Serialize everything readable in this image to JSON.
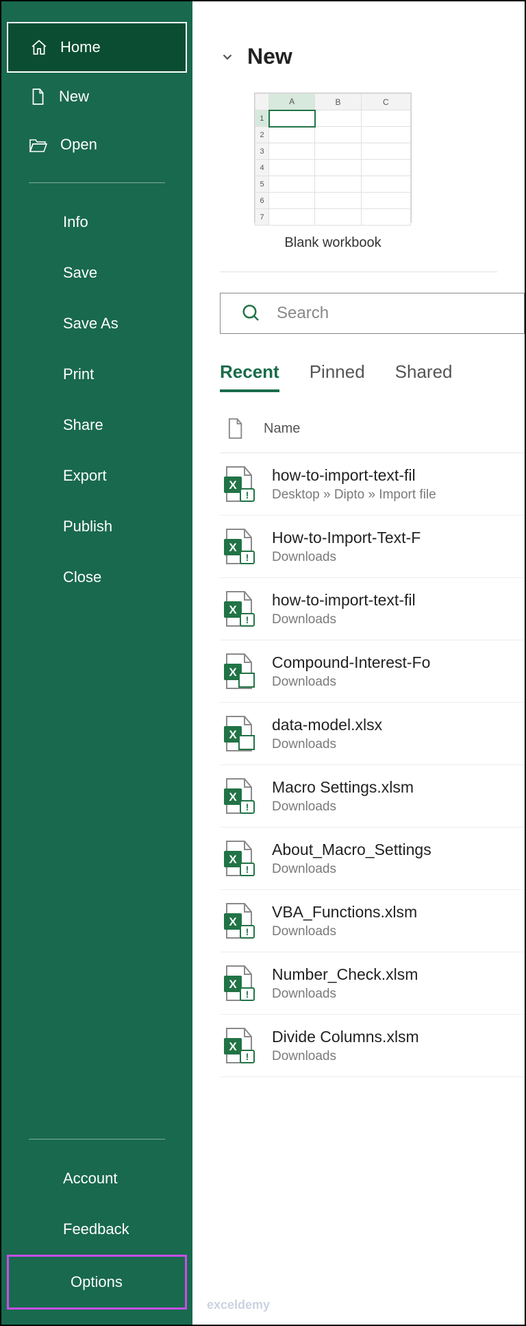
{
  "sidebar": {
    "primary": [
      {
        "label": "Home",
        "icon": "home-icon",
        "selected": true
      },
      {
        "label": "New",
        "icon": "file-icon"
      },
      {
        "label": "Open",
        "icon": "folder-open-icon"
      }
    ],
    "secondary": [
      "Info",
      "Save",
      "Save As",
      "Print",
      "Share",
      "Export",
      "Publish",
      "Close"
    ],
    "bottom": [
      "Account",
      "Feedback",
      "Options"
    ]
  },
  "main": {
    "sectionTitle": "New",
    "tileLabel": "Blank workbook",
    "searchPlaceholder": "Search",
    "tabs": [
      "Recent",
      "Pinned",
      "Shared"
    ],
    "activeTab": "Recent",
    "listHeader": "Name",
    "files": [
      {
        "name": "how-to-import-text-fil",
        "path": "Desktop » Dipto » Import file",
        "type": "xlsm"
      },
      {
        "name": "How-to-Import-Text-F",
        "path": "Downloads",
        "type": "xlsm"
      },
      {
        "name": "how-to-import-text-fil",
        "path": "Downloads",
        "type": "xlsm"
      },
      {
        "name": "Compound-Interest-Fo",
        "path": "Downloads",
        "type": "xlsx"
      },
      {
        "name": "data-model.xlsx",
        "path": "Downloads",
        "type": "xlsx"
      },
      {
        "name": "Macro Settings.xlsm",
        "path": "Downloads",
        "type": "xlsm"
      },
      {
        "name": "About_Macro_Settings",
        "path": "Downloads",
        "type": "xlsm"
      },
      {
        "name": "VBA_Functions.xlsm",
        "path": "Downloads",
        "type": "xlsm"
      },
      {
        "name": "Number_Check.xlsm",
        "path": "Downloads",
        "type": "xlsm"
      },
      {
        "name": "Divide Columns.xlsm",
        "path": "Downloads",
        "type": "xlsm"
      }
    ]
  },
  "watermark": "exceldemy"
}
